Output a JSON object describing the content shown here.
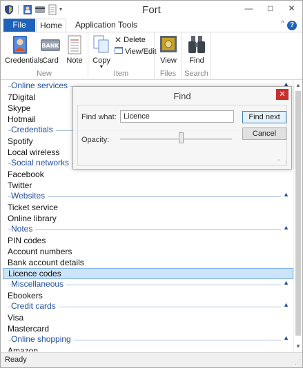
{
  "app": {
    "title": "Fort"
  },
  "ribbon_tabs": {
    "file": "File",
    "home": "Home",
    "application": "Application",
    "tools": "Tools"
  },
  "ribbon": {
    "new_group": {
      "label": "New",
      "credentials": "Credentials",
      "card": "Card",
      "card_icon_text": "BANK",
      "note": "Note"
    },
    "item_group": {
      "label": "Item",
      "copy": "Copy",
      "delete": "Delete",
      "view_edit": "View/Edit"
    },
    "files_group": {
      "label": "Files",
      "view": "View"
    },
    "search_group": {
      "label": "Search",
      "find": "Find"
    }
  },
  "list": {
    "groups": [
      {
        "title": "Online services",
        "items": [
          "7Digital",
          "Skype",
          "Hotmail"
        ]
      },
      {
        "title": "Credentials",
        "items": [
          "Spotify",
          "Local wireless"
        ]
      },
      {
        "title": "Social networks",
        "items": [
          "Facebook",
          "Twitter"
        ]
      },
      {
        "title": "Websites",
        "items": [
          "Ticket service",
          "Online library"
        ]
      },
      {
        "title": "Notes",
        "items": [
          "PIN codes",
          "Account numbers",
          "Bank account details",
          "Licence codes"
        ]
      },
      {
        "title": "Miscellaneous",
        "items": [
          "Ebookers"
        ]
      },
      {
        "title": "Credit cards",
        "items": [
          "Visa",
          "Mastercard"
        ]
      },
      {
        "title": "Online shopping",
        "items": [
          "Amazon"
        ]
      }
    ],
    "selected_item": "Licence codes"
  },
  "find_dialog": {
    "title": "Find",
    "find_what_label": "Find what:",
    "find_what_value": "Licence",
    "find_next": "Find next",
    "cancel": "Cancel",
    "opacity_label": "Opacity:",
    "opacity_level": 0.55
  },
  "status": {
    "text": "Ready"
  },
  "colors": {
    "accent": "#1e63b8",
    "group_header": "#1e4e9c",
    "selection": "#cce4f7",
    "close": "#c7302b"
  }
}
